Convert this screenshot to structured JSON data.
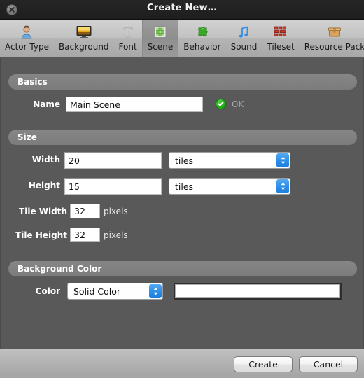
{
  "window": {
    "title": "Create New…",
    "close_icon": "close-icon"
  },
  "toolbar": {
    "items": [
      {
        "label": "Actor Type",
        "icon": "actor-type-icon",
        "selected": false
      },
      {
        "label": "Background",
        "icon": "background-icon",
        "selected": false
      },
      {
        "label": "Font",
        "icon": "font-icon",
        "selected": false
      },
      {
        "label": "Scene",
        "icon": "scene-icon",
        "selected": true
      },
      {
        "label": "Behavior",
        "icon": "behavior-puzzle-icon",
        "selected": false
      },
      {
        "label": "Sound",
        "icon": "sound-note-icon",
        "selected": false
      },
      {
        "label": "Tileset",
        "icon": "tileset-brick-icon",
        "selected": false
      },
      {
        "label": "Resource Pack",
        "icon": "resource-pack-box-icon",
        "selected": false
      }
    ]
  },
  "sections": {
    "basics": {
      "header": "Basics",
      "name_label": "Name",
      "name_value": "Main Scene",
      "name_placeholder": "",
      "status_icon": "check-circle-icon",
      "status_text": "OK"
    },
    "size": {
      "header": "Size",
      "width_label": "Width",
      "width_value": "20",
      "width_unit": "tiles",
      "height_label": "Height",
      "height_value": "15",
      "height_unit": "tiles",
      "tile_width_label": "Tile Width",
      "tile_width_value": "32",
      "tile_width_unit": "pixels",
      "tile_height_label": "Tile Height",
      "tile_height_value": "32",
      "tile_height_unit": "pixels"
    },
    "background_color": {
      "header": "Background Color",
      "color_label": "Color",
      "color_mode": "Solid Color",
      "swatch_color": "#ffffff"
    }
  },
  "footer": {
    "create_label": "Create",
    "cancel_label": "Cancel"
  },
  "colors": {
    "panel_bg": "#595959",
    "titlebar_bg": "#1f1f1f",
    "accent_blue": "#2f8fe8",
    "ok_green": "#2bb11f"
  }
}
